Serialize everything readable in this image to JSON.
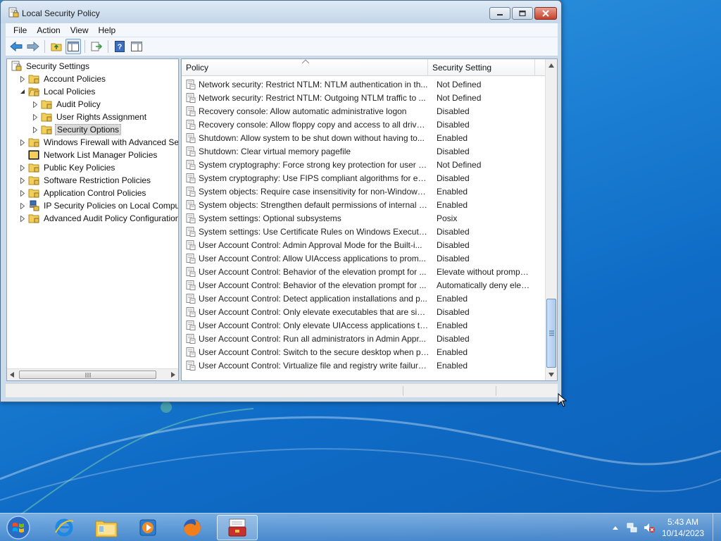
{
  "window": {
    "title": "Local Security Policy",
    "minimize_label": "",
    "maximize_label": "",
    "close_label": ""
  },
  "menu": [
    "File",
    "Action",
    "View",
    "Help"
  ],
  "toolbar": {
    "icons": [
      "back-arrow-icon",
      "forward-arrow-icon",
      "up-folder-icon",
      "show-hide-tree-icon",
      "export-list-icon",
      "help-icon",
      "properties-pane-icon"
    ]
  },
  "tree": {
    "root": "Security Settings",
    "items": [
      {
        "label": "Security Settings",
        "level": 0,
        "expander": "none",
        "icon": "security-settings-icon"
      },
      {
        "label": "Account Policies",
        "level": 1,
        "expander": "collapsed",
        "icon": "folder-icon"
      },
      {
        "label": "Local Policies",
        "level": 1,
        "expander": "expanded",
        "icon": "folder-open-icon"
      },
      {
        "label": "Audit Policy",
        "level": 2,
        "expander": "collapsed",
        "icon": "folder-icon"
      },
      {
        "label": "User Rights Assignment",
        "level": 2,
        "expander": "collapsed",
        "icon": "folder-icon"
      },
      {
        "label": "Security Options",
        "level": 2,
        "expander": "collapsed",
        "icon": "folder-icon",
        "selected": true
      },
      {
        "label": "Windows Firewall with Advanced Secu",
        "level": 1,
        "expander": "collapsed",
        "icon": "folder-icon"
      },
      {
        "label": "Network List Manager Policies",
        "level": 1,
        "expander": "none",
        "icon": "folder-dark-icon"
      },
      {
        "label": "Public Key Policies",
        "level": 1,
        "expander": "collapsed",
        "icon": "folder-icon"
      },
      {
        "label": "Software Restriction Policies",
        "level": 1,
        "expander": "collapsed",
        "icon": "folder-icon"
      },
      {
        "label": "Application Control Policies",
        "level": 1,
        "expander": "collapsed",
        "icon": "folder-icon"
      },
      {
        "label": "IP Security Policies on Local Compute",
        "level": 1,
        "expander": "collapsed",
        "icon": "ip-security-icon"
      },
      {
        "label": "Advanced Audit Policy Configuration",
        "level": 1,
        "expander": "collapsed",
        "icon": "folder-icon"
      }
    ]
  },
  "list": {
    "columns": {
      "policy": "Policy",
      "setting": "Security Setting"
    },
    "rows": [
      {
        "policy": "Network security: Restrict NTLM: NTLM authentication in th...",
        "setting": "Not Defined"
      },
      {
        "policy": "Network security: Restrict NTLM: Outgoing NTLM traffic to ...",
        "setting": "Not Defined"
      },
      {
        "policy": "Recovery console: Allow automatic administrative logon",
        "setting": "Disabled"
      },
      {
        "policy": "Recovery console: Allow floppy copy and access to all drives...",
        "setting": "Disabled"
      },
      {
        "policy": "Shutdown: Allow system to be shut down without having to...",
        "setting": "Enabled"
      },
      {
        "policy": "Shutdown: Clear virtual memory pagefile",
        "setting": "Disabled"
      },
      {
        "policy": "System cryptography: Force strong key protection for user k...",
        "setting": "Not Defined"
      },
      {
        "policy": "System cryptography: Use FIPS compliant algorithms for en...",
        "setting": "Disabled"
      },
      {
        "policy": "System objects: Require case insensitivity for non-Windows ...",
        "setting": "Enabled"
      },
      {
        "policy": "System objects: Strengthen default permissions of internal s...",
        "setting": "Enabled"
      },
      {
        "policy": "System settings: Optional subsystems",
        "setting": "Posix"
      },
      {
        "policy": "System settings: Use Certificate Rules on Windows Executabl...",
        "setting": "Disabled"
      },
      {
        "policy": "User Account Control: Admin Approval Mode for the Built-i...",
        "setting": "Disabled"
      },
      {
        "policy": "User Account Control: Allow UIAccess applications to prom...",
        "setting": "Disabled"
      },
      {
        "policy": "User Account Control: Behavior of the elevation prompt for ...",
        "setting": "Elevate without prompti..."
      },
      {
        "policy": "User Account Control: Behavior of the elevation prompt for ...",
        "setting": "Automatically deny elev..."
      },
      {
        "policy": "User Account Control: Detect application installations and p...",
        "setting": "Enabled"
      },
      {
        "policy": "User Account Control: Only elevate executables that are sign...",
        "setting": "Disabled"
      },
      {
        "policy": "User Account Control: Only elevate UIAccess applications th...",
        "setting": "Enabled"
      },
      {
        "policy": "User Account Control: Run all administrators in Admin Appr...",
        "setting": "Disabled"
      },
      {
        "policy": "User Account Control: Switch to the secure desktop when pr...",
        "setting": "Enabled"
      },
      {
        "policy": "User Account Control: Virtualize file and registry write failure...",
        "setting": "Enabled"
      }
    ]
  },
  "taskbar": {
    "apps": [
      "internet-explorer-icon",
      "windows-explorer-icon",
      "media-player-icon",
      "firefox-icon",
      "security-policy-toolbox-icon"
    ],
    "active_app": "security-policy-toolbox-icon",
    "tray_icons": [
      "show-hidden-icons-arrow",
      "network-icon",
      "volume-muted-icon"
    ],
    "time": "5:43 AM",
    "date": "10/14/2023"
  },
  "colors": {
    "desktop": "#1c7fd3",
    "window_frame": "#cbdbea",
    "selection": "#d9d9d9",
    "close_button": "#c7402a"
  }
}
